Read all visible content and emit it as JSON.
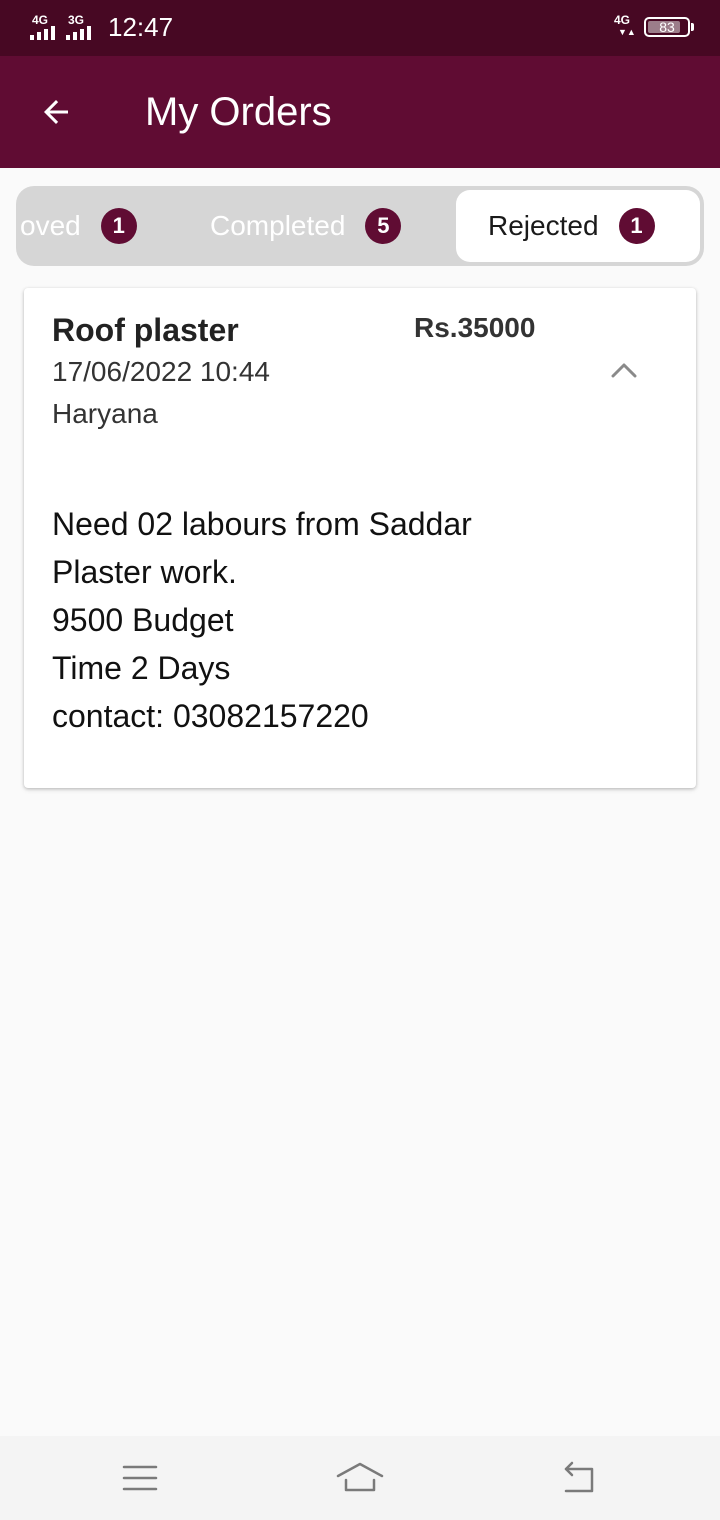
{
  "status_bar": {
    "network1": "4G",
    "network2": "3G",
    "time": "12:47",
    "network3": "4G",
    "battery": "83",
    "battery_level": 0.83
  },
  "app_bar": {
    "title": "My Orders",
    "back_icon": "arrow-left-icon"
  },
  "tabs": [
    {
      "label": "oved",
      "count": "1",
      "active": false
    },
    {
      "label": "Completed",
      "count": "5",
      "active": false
    },
    {
      "label": "Rejected",
      "count": "1",
      "active": true
    }
  ],
  "order": {
    "title": "Roof plaster",
    "price": "Rs.35000",
    "date": "17/06/2022 10:44",
    "location": "Haryana",
    "description": [
      "Need 02 labours from Saddar",
      "Plaster work.",
      "9500 Budget",
      "Time 2 Days",
      "contact: 03082157220"
    ],
    "toggle_icon": "chevron-up-icon"
  },
  "nav_bar": {
    "icons": [
      "menu-icon",
      "home-icon",
      "back-icon"
    ]
  },
  "colors": {
    "status_bar": "#470823",
    "app_bar": "#600c33",
    "badge": "#600c33",
    "tab_track": "#d6d6d6"
  }
}
